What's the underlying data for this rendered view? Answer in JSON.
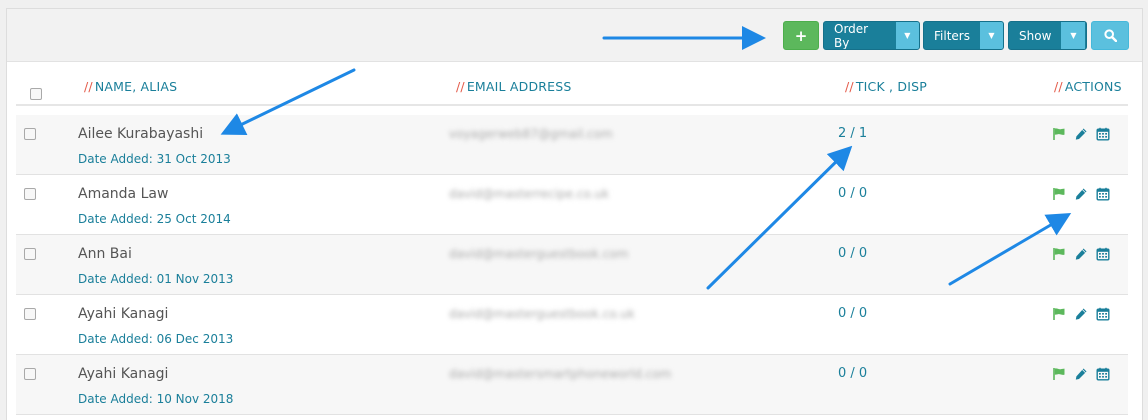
{
  "toolbar": {
    "add_label": "+",
    "order_by_label": "Order By",
    "filters_label": "Filters",
    "show_label": "Show"
  },
  "columns": {
    "name": "NAME, ALIAS",
    "email": "EMAIL ADDRESS",
    "tick": "TICK , DISP",
    "actions": "ACTIONS",
    "prefix": "//"
  },
  "rows": [
    {
      "name": "Ailee Kurabayashi",
      "date": "Date Added: 31 Oct 2013",
      "email": "voyagerweb87@gmail.com",
      "tick": "2 / 1"
    },
    {
      "name": "Amanda Law",
      "date": "Date Added: 25 Oct 2014",
      "email": "david@masterrecipe.co.uk",
      "tick": "0 / 0"
    },
    {
      "name": "Ann Bai",
      "date": "Date Added: 01 Nov 2013",
      "email": "david@masterguestbook.com",
      "tick": "0 / 0"
    },
    {
      "name": "Ayahi Kanagi",
      "date": "Date Added: 06 Dec 2013",
      "email": "david@masterguestbook.co.uk",
      "tick": "0 / 0"
    },
    {
      "name": "Ayahi Kanagi",
      "date": "Date Added: 10 Nov 2018",
      "email": "david@mastersmartphoneworld.com",
      "tick": "0 / 0"
    }
  ],
  "colors": {
    "accent": "#1a7f9a",
    "success": "#5cb85c",
    "info": "#5bc0de",
    "header_prefix": "#e45b4a",
    "annotation_arrow": "#1e88e5"
  }
}
